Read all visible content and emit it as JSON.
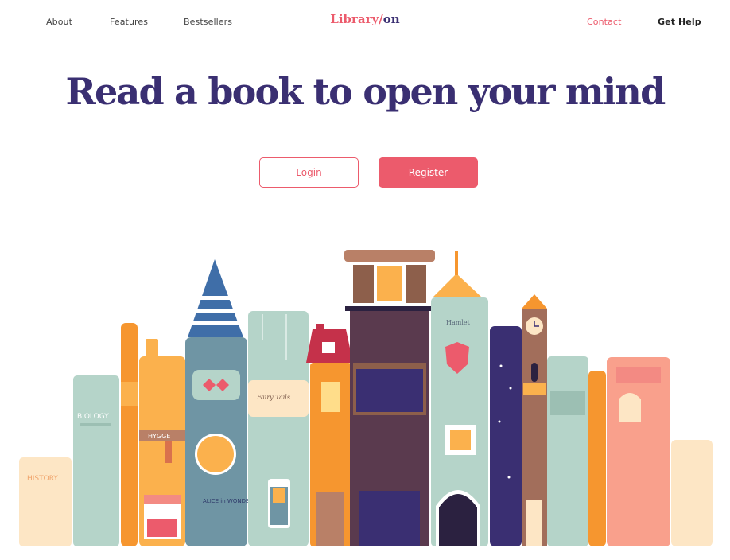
{
  "nav": {
    "left": [
      "About",
      "Features",
      "Bestsellers"
    ],
    "right": {
      "contact": "Contact",
      "help": "Get Help"
    }
  },
  "logo": {
    "part1": "Library",
    "slash": "/",
    "part2": "on"
  },
  "hero": {
    "title": "Read a book to open your mind"
  },
  "buttons": {
    "login": "Login",
    "register": "Register"
  },
  "books": {
    "history": "HISTORY",
    "biology": "BIOLOGY",
    "hygge": "HYGGE",
    "alice": "ALICE in WONDERLAND",
    "fairy_tales": "Fairy Tails",
    "hamlet": "Hamlet"
  },
  "colors": {
    "accent": "#ec5b6c",
    "brand": "#3a2f72"
  }
}
